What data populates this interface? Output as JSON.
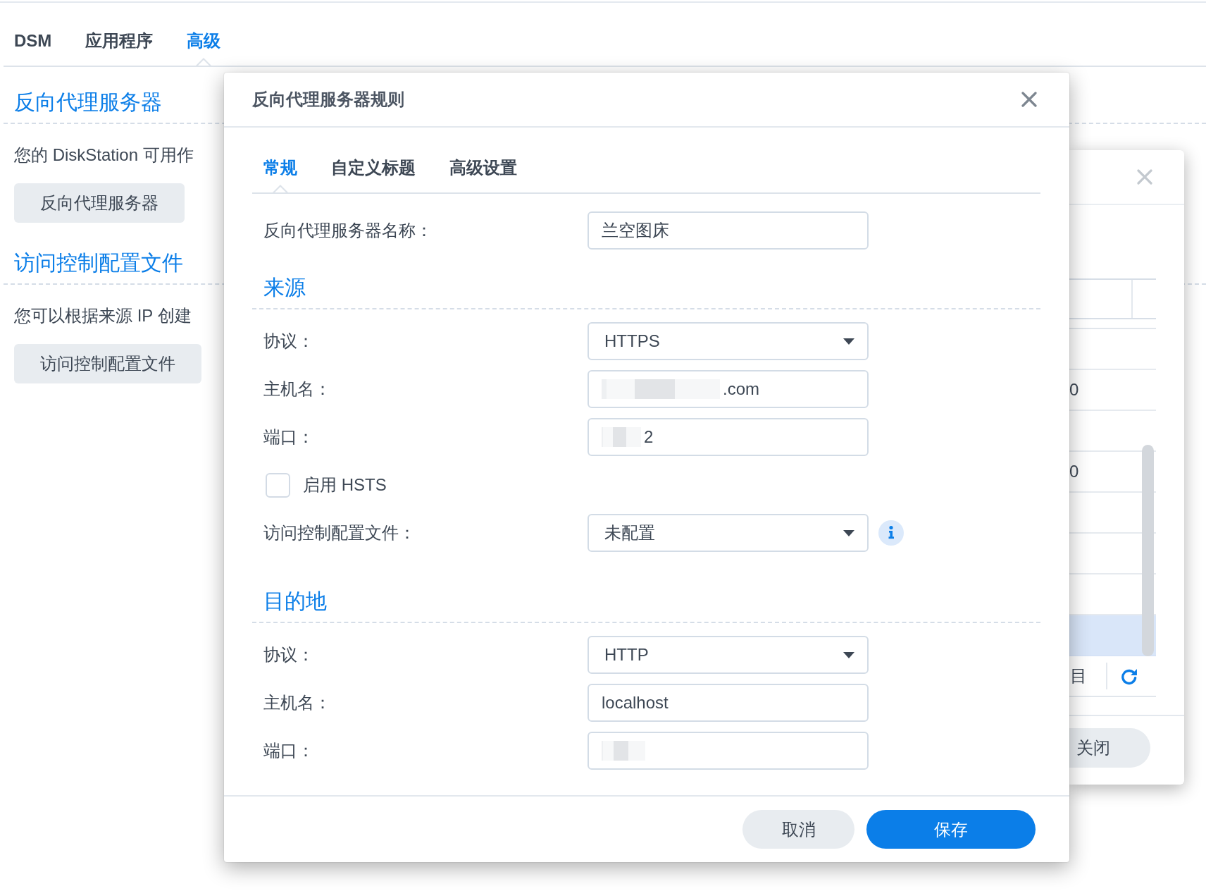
{
  "top_tabs": [
    {
      "label": "DSM",
      "selected": false
    },
    {
      "label": "应用程序",
      "selected": false
    },
    {
      "label": "高级",
      "selected": true
    }
  ],
  "sections": [
    {
      "title": "反向代理服务器",
      "description": "您的 DiskStation 可用作",
      "button": "反向代理服务器"
    },
    {
      "title": "访问控制配置文件",
      "description": "您可以根据来源 IP 创建",
      "button": "访问控制配置文件"
    }
  ],
  "back_dialog": {
    "rows": [
      {
        "selected": false
      },
      {
        "cell": "0",
        "selected": false
      },
      {
        "selected": false
      },
      {
        "cell": "0",
        "selected": false
      },
      {
        "selected": false
      },
      {
        "selected": false
      },
      {
        "selected": false
      },
      {
        "selected": true
      }
    ],
    "status": "目",
    "close_button": "关闭"
  },
  "rule_dialog": {
    "title": "反向代理服务器规则",
    "tabs": [
      {
        "label": "常规",
        "selected": true
      },
      {
        "label": "自定义标题",
        "selected": false
      },
      {
        "label": "高级设置",
        "selected": false
      }
    ],
    "name_field": {
      "label": "反向代理服务器名称：",
      "value": "兰空图床"
    },
    "groups": [
      {
        "title": "来源",
        "fields": [
          {
            "kind": "select",
            "label": "协议：",
            "value": "HTTPS"
          },
          {
            "kind": "input",
            "label": "主机名：",
            "value": ".com",
            "redacted": true
          },
          {
            "kind": "input",
            "label": "端口：",
            "value": "2",
            "redacted": true
          },
          {
            "kind": "checkbox",
            "label": "启用 HSTS",
            "checked": false
          },
          {
            "kind": "select",
            "label": "访问控制配置文件：",
            "value": "未配置",
            "info": true
          }
        ]
      },
      {
        "title": "目的地",
        "fields": [
          {
            "kind": "select",
            "label": "协议：",
            "value": "HTTP"
          },
          {
            "kind": "input",
            "label": "主机名：",
            "value": "localhost"
          },
          {
            "kind": "input",
            "label": "端口：",
            "redacted": true
          }
        ]
      }
    ],
    "buttons": [
      {
        "kind": "secondary",
        "label": "取消"
      },
      {
        "kind": "primary",
        "label": "保存"
      }
    ]
  }
}
